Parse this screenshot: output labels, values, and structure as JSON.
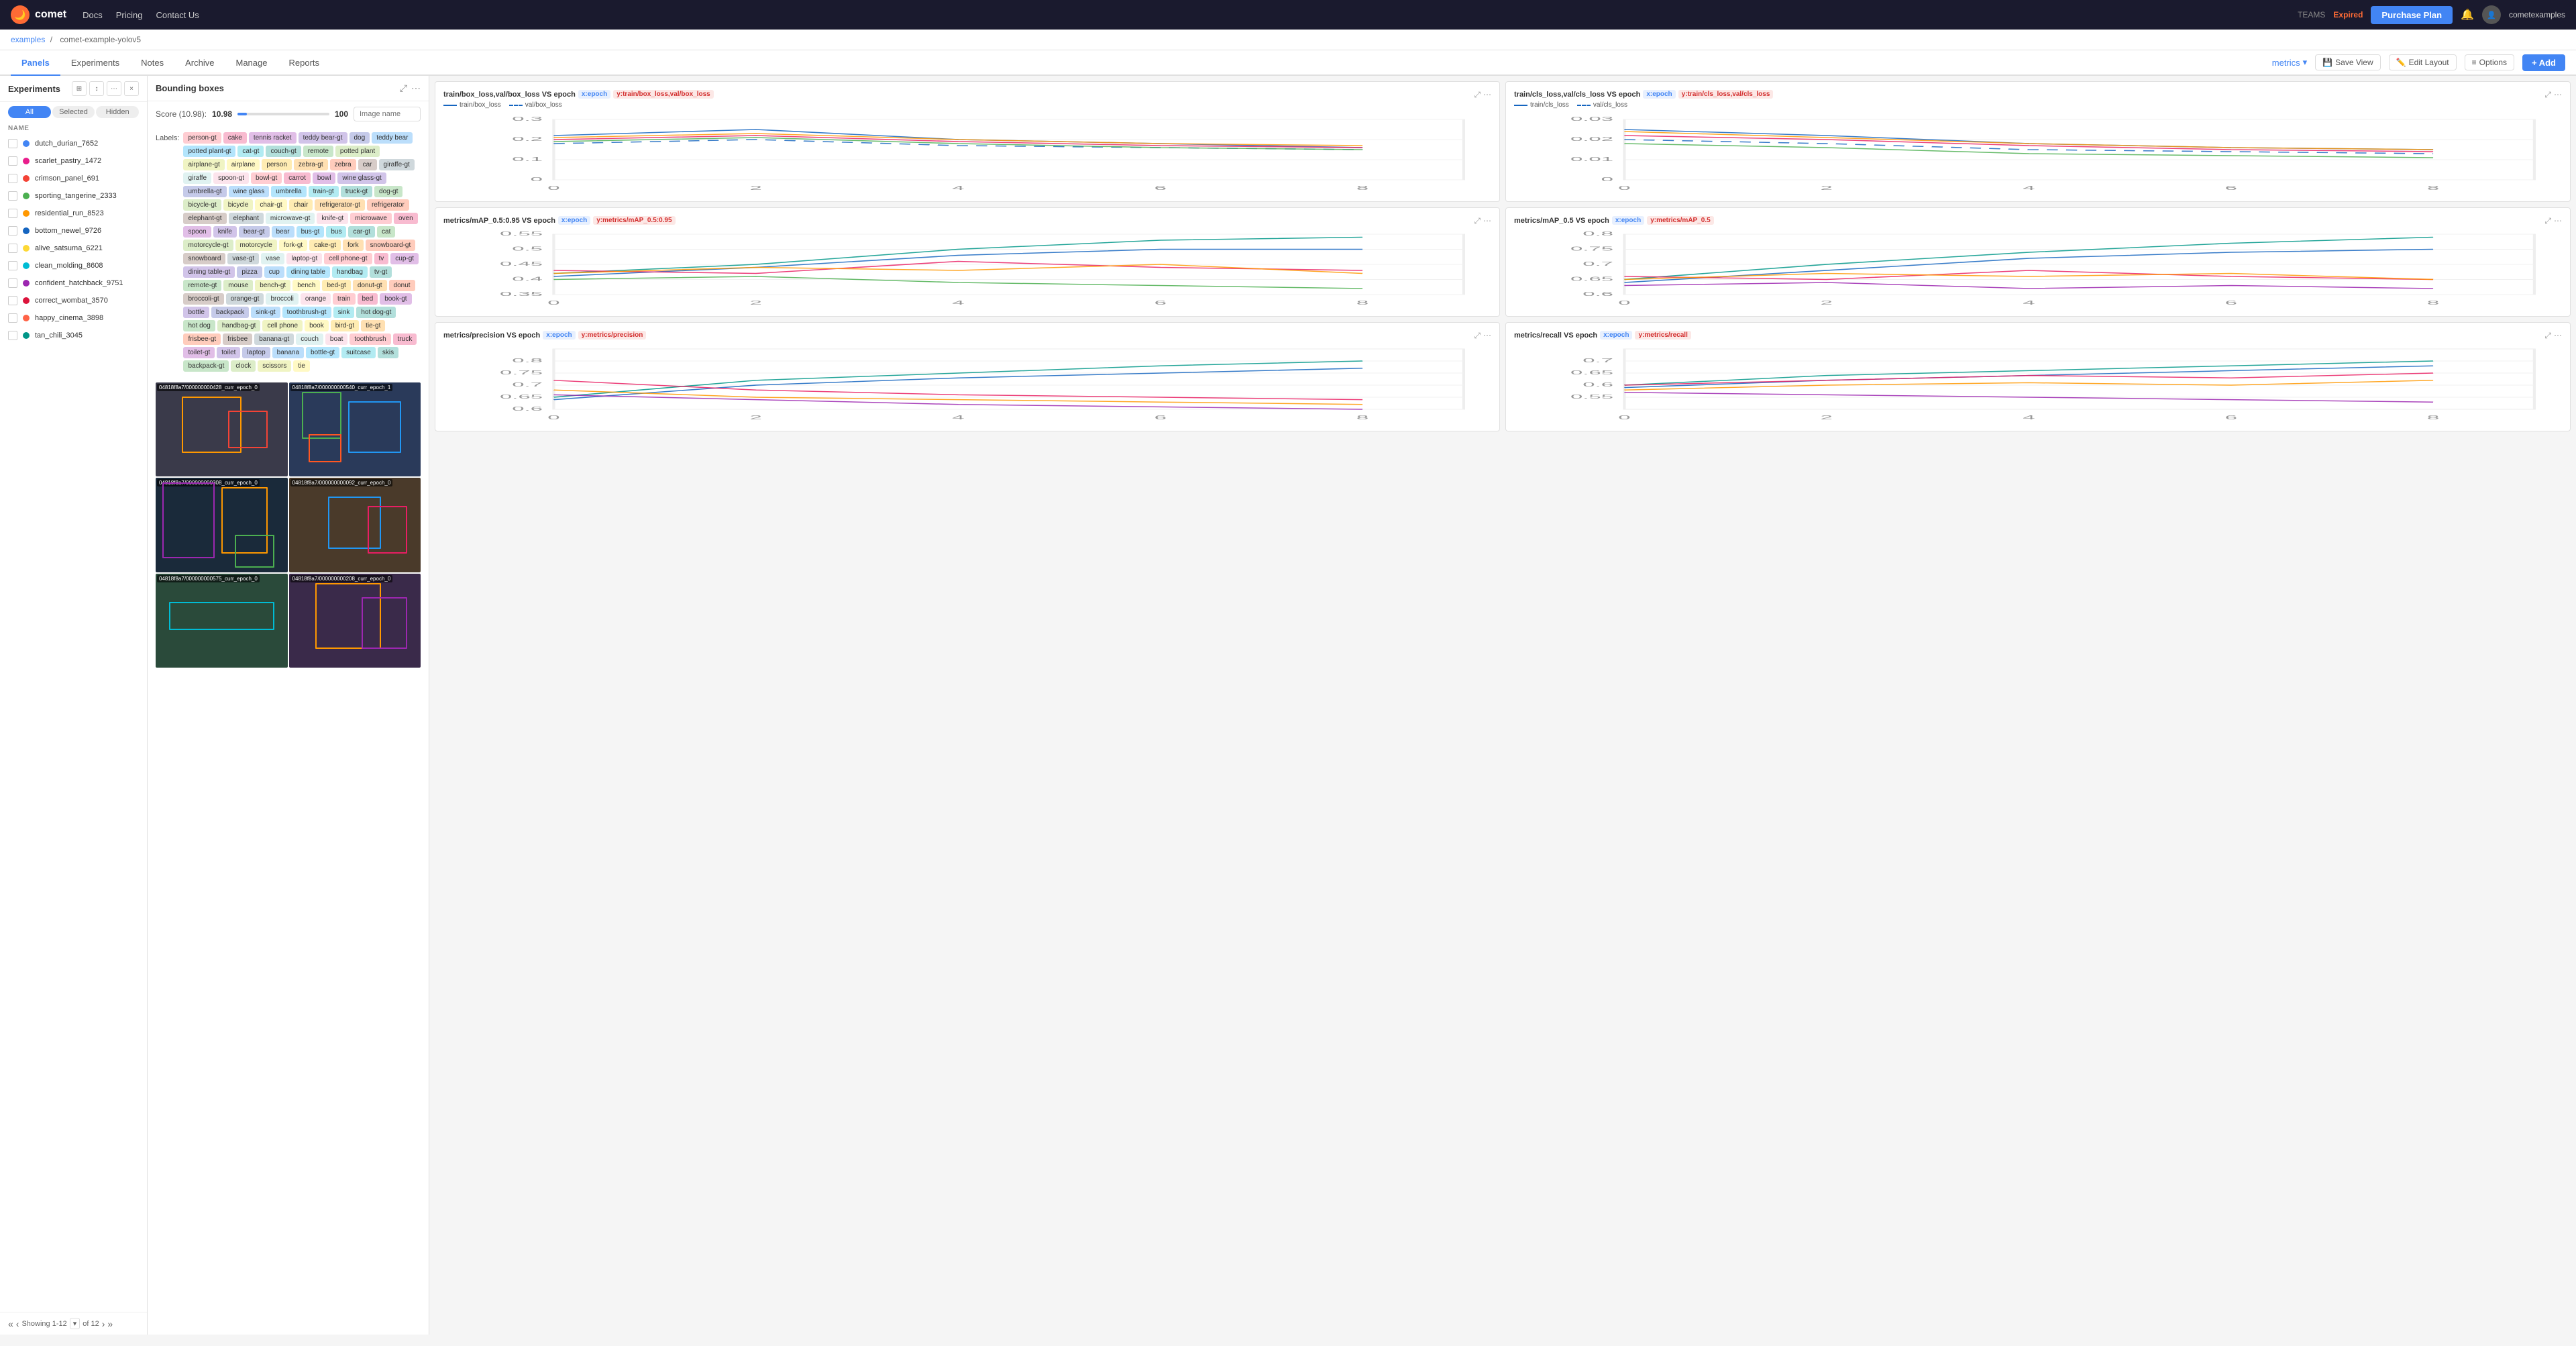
{
  "topnav": {
    "logo_text": "comet",
    "nav_links": [
      "Docs",
      "Pricing",
      "Contact Us"
    ],
    "teams_label": "TEAMS",
    "expired_label": "Expired",
    "purchase_btn": "Purchase Plan",
    "username": "cometexamples"
  },
  "breadcrumb": {
    "part1": "examples",
    "separator": "/",
    "part2": "comet-example-yolov5"
  },
  "tabs": {
    "items": [
      "Panels",
      "Experiments",
      "Notes",
      "Archive",
      "Manage",
      "Reports"
    ],
    "active": "Panels"
  },
  "toolbar": {
    "metrics_label": "metrics",
    "save_view": "Save View",
    "edit_layout": "Edit Layout",
    "options": "Options",
    "add": "+ Add"
  },
  "experiments_panel": {
    "title": "Experiments",
    "filter_all": "All",
    "filter_selected": "Selected",
    "filter_hidden": "Hidden",
    "experiments": [
      {
        "name": "dutch_durian_7652",
        "color": "blue"
      },
      {
        "name": "scarlet_pastry_1472",
        "color": "pink"
      },
      {
        "name": "crimson_panel_691",
        "color": "red"
      },
      {
        "name": "sporting_tangerine_2333",
        "color": "green"
      },
      {
        "name": "residential_run_8523",
        "color": "orange"
      },
      {
        "name": "bottom_newel_9726",
        "color": "darkblue"
      },
      {
        "name": "alive_satsuma_6221",
        "color": "yellow"
      },
      {
        "name": "clean_molding_8608",
        "color": "cyan"
      },
      {
        "name": "confident_hatchback_9751",
        "color": "magenta"
      },
      {
        "name": "correct_wombat_3570",
        "color": "crimson"
      },
      {
        "name": "happy_cinema_3898",
        "color": "coral"
      },
      {
        "name": "tan_chili_3045",
        "color": "teal"
      }
    ],
    "showing": "Showing 1-12",
    "of_total": "of 12"
  },
  "bounding_boxes": {
    "title": "Bounding boxes",
    "score_label": "Score (10.98):",
    "score_value": "10.98",
    "score_max": "100",
    "image_name_placeholder": "Image name",
    "labels_title": "Labels:",
    "labels": [
      {
        "text": "person-gt",
        "color": "#e8f5e9"
      },
      {
        "text": "cake",
        "color": "#fff9c4"
      },
      {
        "text": "tennis racket",
        "color": "#fce4ec"
      },
      {
        "text": "teddy bear-gt",
        "color": "#e3f2fd"
      },
      {
        "text": "dog",
        "color": "#f3e5f5"
      },
      {
        "text": "teddy bear",
        "color": "#e8f5e9"
      },
      {
        "text": "potted plant-gt",
        "color": "#fff3e0"
      },
      {
        "text": "cat-gt",
        "color": "#fce4ec"
      },
      {
        "text": "couch-gt",
        "color": "#e3f2fd"
      },
      {
        "text": "remote",
        "color": "#f3e5f5"
      },
      {
        "text": "potted plant",
        "color": "#e8f5e9"
      },
      {
        "text": "airplane-gt",
        "color": "#fff9c4"
      },
      {
        "text": "airplane",
        "color": "#fce4ec"
      },
      {
        "text": "person",
        "color": "#e3f2fd"
      },
      {
        "text": "zebra-gt",
        "color": "#f3e5f5"
      },
      {
        "text": "zebra",
        "color": "#e8f5e9"
      },
      {
        "text": "car",
        "color": "#fff3e0"
      },
      {
        "text": "giraffe-gt",
        "color": "#fce4ec"
      },
      {
        "text": "giraffe",
        "color": "#e3f2fd"
      },
      {
        "text": "spoon-gt",
        "color": "#f3e5f5"
      },
      {
        "text": "bowl-gt",
        "color": "#e8f5e9"
      },
      {
        "text": "carrot",
        "color": "#fff9c4"
      },
      {
        "text": "bowl",
        "color": "#fce4ec"
      },
      {
        "text": "wine glass-gt",
        "color": "#e3f2fd"
      },
      {
        "text": "umbrella-gt",
        "color": "#f3e5f5"
      },
      {
        "text": "wine glass",
        "color": "#e8f5e9"
      },
      {
        "text": "umbrella",
        "color": "#fff3e0"
      },
      {
        "text": "train-gt",
        "color": "#fce4ec"
      },
      {
        "text": "truck-gt",
        "color": "#e3f2fd"
      },
      {
        "text": "dog-gt",
        "color": "#f3e5f5"
      },
      {
        "text": "bicycle-gt",
        "color": "#e8f5e9"
      },
      {
        "text": "bicycle",
        "color": "#fff9c4"
      },
      {
        "text": "chair-gt",
        "color": "#fce4ec"
      },
      {
        "text": "chair",
        "color": "#e3f2fd"
      },
      {
        "text": "refrigerator-gt",
        "color": "#f3e5f5"
      },
      {
        "text": "refrigerator",
        "color": "#e8f5e9"
      },
      {
        "text": "elephant-gt",
        "color": "#fff3e0"
      },
      {
        "text": "elephant",
        "color": "#fce4ec"
      },
      {
        "text": "microwave-gt",
        "color": "#e3f2fd"
      },
      {
        "text": "knife-gt",
        "color": "#f3e5f5"
      },
      {
        "text": "microwave",
        "color": "#e8f5e9"
      },
      {
        "text": "oven",
        "color": "#fff9c4"
      },
      {
        "text": "spoon",
        "color": "#fce4ec"
      },
      {
        "text": "knife",
        "color": "#e3f2fd"
      },
      {
        "text": "bear-gt",
        "color": "#f3e5f5"
      },
      {
        "text": "bear",
        "color": "#e8f5e9"
      },
      {
        "text": "bus-gt",
        "color": "#fff3e0"
      },
      {
        "text": "bus",
        "color": "#fce4ec"
      },
      {
        "text": "car-gt",
        "color": "#e3f2fd"
      },
      {
        "text": "cat",
        "color": "#f3e5f5"
      },
      {
        "text": "motorcycle-gt",
        "color": "#e8f5e9"
      },
      {
        "text": "motorcycle",
        "color": "#fff9c4"
      },
      {
        "text": "fork-gt",
        "color": "#fce4ec"
      },
      {
        "text": "cake-gt",
        "color": "#e3f2fd"
      },
      {
        "text": "fork",
        "color": "#f3e5f5"
      },
      {
        "text": "snowboard-gt",
        "color": "#e8f5e9"
      },
      {
        "text": "snowboard",
        "color": "#fff3e0"
      },
      {
        "text": "vase-gt",
        "color": "#fce4ec"
      },
      {
        "text": "vase",
        "color": "#e3f2fd"
      },
      {
        "text": "laptop-gt",
        "color": "#f3e5f5"
      },
      {
        "text": "cell phone-gt",
        "color": "#e8f5e9"
      },
      {
        "text": "tv",
        "color": "#fff9c4"
      },
      {
        "text": "cup-gt",
        "color": "#fce4ec"
      },
      {
        "text": "dining table-gt",
        "color": "#e3f2fd"
      },
      {
        "text": "pizza",
        "color": "#f3e5f5"
      },
      {
        "text": "cup",
        "color": "#e8f5e9"
      },
      {
        "text": "dining table",
        "color": "#fff3e0"
      },
      {
        "text": "handbag",
        "color": "#fce4ec"
      },
      {
        "text": "tv-gt",
        "color": "#e3f2fd"
      },
      {
        "text": "remote-gt",
        "color": "#f3e5f5"
      },
      {
        "text": "mouse",
        "color": "#e8f5e9"
      },
      {
        "text": "bench-gt",
        "color": "#fff9c4"
      },
      {
        "text": "bench",
        "color": "#fce4ec"
      },
      {
        "text": "bed-gt",
        "color": "#e3f2fd"
      },
      {
        "text": "donut-gt",
        "color": "#f3e5f5"
      },
      {
        "text": "donut",
        "color": "#e8f5e9"
      },
      {
        "text": "broccoli-gt",
        "color": "#fff3e0"
      },
      {
        "text": "orange-gt",
        "color": "#fce4ec"
      },
      {
        "text": "broccoli",
        "color": "#e3f2fd"
      },
      {
        "text": "orange",
        "color": "#f3e5f5"
      },
      {
        "text": "train",
        "color": "#e8f5e9"
      },
      {
        "text": "bed",
        "color": "#fff9c4"
      },
      {
        "text": "book-gt",
        "color": "#fce4ec"
      },
      {
        "text": "bottle",
        "color": "#e3f2fd"
      },
      {
        "text": "backpack",
        "color": "#f3e5f5"
      },
      {
        "text": "sink-gt",
        "color": "#e8f5e9"
      },
      {
        "text": "toothbrush-gt",
        "color": "#fff3e0"
      },
      {
        "text": "sink",
        "color": "#fce4ec"
      },
      {
        "text": "hot dog-gt",
        "color": "#e3f2fd"
      },
      {
        "text": "hot dog",
        "color": "#f3e5f5"
      },
      {
        "text": "handbag-gt",
        "color": "#e8f5e9"
      },
      {
        "text": "cell phone",
        "color": "#fff9c4"
      },
      {
        "text": "book",
        "color": "#fce4ec"
      },
      {
        "text": "bird-gt",
        "color": "#e3f2fd"
      },
      {
        "text": "tie-gt",
        "color": "#f3e5f5"
      },
      {
        "text": "frisbee-gt",
        "color": "#e8f5e9"
      },
      {
        "text": "frisbee",
        "color": "#fff3e0"
      },
      {
        "text": "banana-gt",
        "color": "#fce4ec"
      },
      {
        "text": "couch",
        "color": "#e3f2fd"
      },
      {
        "text": "boat",
        "color": "#f3e5f5"
      },
      {
        "text": "toothbrush",
        "color": "#e8f5e9"
      },
      {
        "text": "truck",
        "color": "#fff9c4"
      },
      {
        "text": "toilet-gt",
        "color": "#fce4ec"
      },
      {
        "text": "toilet",
        "color": "#e3f2fd"
      },
      {
        "text": "laptop",
        "color": "#f3e5f5"
      },
      {
        "text": "banana",
        "color": "#e8f5e9"
      },
      {
        "text": "bottle-gt",
        "color": "#fff3e0"
      },
      {
        "text": "suitcase",
        "color": "#fce4ec"
      },
      {
        "text": "skis",
        "color": "#e3f2fd"
      },
      {
        "text": "backpack-gt",
        "color": "#f3e5f5"
      },
      {
        "text": "clock",
        "color": "#e8f5e9"
      },
      {
        "text": "scissors",
        "color": "#fff9c4"
      },
      {
        "text": "tie",
        "color": "#fce4ec"
      }
    ],
    "images": [
      {
        "id": "04818f8a7/000000000428_curr_epoch_0",
        "short": "428"
      },
      {
        "id": "04818f8a7/000000000540_curr_epoch_1",
        "short": "540"
      },
      {
        "id": "04818f8a7/000000000308_curr_epoch_0",
        "short": "308"
      },
      {
        "id": "04818f8a7/000000000092_curr_epoch_0",
        "short": "092"
      },
      {
        "id": "04818f8a7/000000000575_curr_epoch_0",
        "short": "575"
      },
      {
        "id": "04818f8a7/000000000208_curr_epoch_0",
        "short": "208"
      }
    ]
  },
  "charts": [
    {
      "id": "box_loss",
      "title": "train/box_loss,val/box_loss VS epoch",
      "x_tag": "x:epoch",
      "y_tag": "y:train/box_loss,val/box_loss",
      "legend": [
        {
          "label": "train/box_loss",
          "color": "#1565c0",
          "dashed": false
        },
        {
          "label": "val/box_loss",
          "color": "#1565c0",
          "dashed": true
        }
      ],
      "y_min": 0,
      "y_max": 0.3,
      "y_ticks": [
        "0.3",
        "0.2",
        "0.1",
        "0"
      ],
      "x_ticks": [
        "0",
        "2",
        "4",
        "6",
        "8"
      ]
    },
    {
      "id": "cls_loss",
      "title": "train/cls_loss,val/cls_loss VS epoch",
      "x_tag": "x:epoch",
      "y_tag": "y:train/cls_loss,val/cls_loss",
      "legend": [
        {
          "label": "train/cls_loss",
          "color": "#1565c0",
          "dashed": false
        },
        {
          "label": "val/cls_loss",
          "color": "#1565c0",
          "dashed": true
        }
      ],
      "y_min": 0,
      "y_max": 0.03,
      "y_ticks": [
        "0.03",
        "0.02",
        "0.01",
        "0"
      ],
      "x_ticks": [
        "0",
        "2",
        "4",
        "6",
        "8"
      ]
    },
    {
      "id": "map_095",
      "title": "metrics/mAP_0.5:0.95 VS epoch",
      "x_tag": "x:epoch",
      "y_tag": "y:metrics/mAP_0.5:0.95",
      "y_min": 0.35,
      "y_max": 0.55,
      "y_ticks": [
        "0.55",
        "0.5",
        "0.45",
        "0.4",
        "0.35"
      ],
      "x_ticks": [
        "0",
        "2",
        "4",
        "6",
        "8"
      ]
    },
    {
      "id": "map_05",
      "title": "metrics/mAP_0.5 VS epoch",
      "x_tag": "x:epoch",
      "y_tag": "y:metrics/mAP_0.5",
      "y_min": 0.6,
      "y_max": 0.8,
      "y_ticks": [
        "0.8",
        "0.75",
        "0.7",
        "0.65",
        "0.6"
      ],
      "x_ticks": [
        "0",
        "2",
        "4",
        "6",
        "8"
      ]
    },
    {
      "id": "precision",
      "title": "metrics/precision VS epoch",
      "x_tag": "x:epoch",
      "y_tag": "y:metrics/precision",
      "y_min": 0.6,
      "y_max": 0.85,
      "y_ticks": [
        "0.8",
        "0.75",
        "0.7",
        "0.65",
        "0.6"
      ],
      "x_ticks": [
        "0",
        "2",
        "4",
        "6",
        "8"
      ]
    },
    {
      "id": "recall",
      "title": "metrics/recall VS epoch",
      "x_tag": "x:epoch",
      "y_tag": "y:metrics/recall",
      "y_min": 0.5,
      "y_max": 0.75,
      "y_ticks": [
        "0.7",
        "0.65",
        "0.6",
        "0.55"
      ],
      "x_ticks": [
        "0",
        "2",
        "4",
        "6",
        "8"
      ]
    }
  ]
}
